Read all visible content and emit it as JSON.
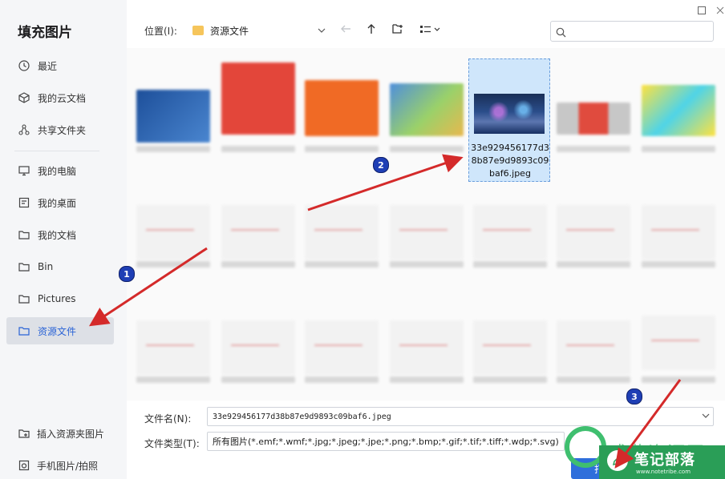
{
  "dialog": {
    "title": "填充图片"
  },
  "sidebar": {
    "items": [
      {
        "label": "最近",
        "icon": "clock-icon"
      },
      {
        "label": "我的云文档",
        "icon": "cloud-cube-icon"
      },
      {
        "label": "共享文件夹",
        "icon": "share-icon"
      },
      {
        "label": "我的电脑",
        "icon": "monitor-icon"
      },
      {
        "label": "我的桌面",
        "icon": "desktop-icon"
      },
      {
        "label": "我的文档",
        "icon": "folder-icon"
      },
      {
        "label": "Bin",
        "icon": "folder-icon"
      },
      {
        "label": "Pictures",
        "icon": "folder-icon"
      },
      {
        "label": "资源文件",
        "icon": "folder-icon",
        "active": true
      }
    ],
    "bottom": [
      {
        "label": "插入资源夹图片",
        "icon": "insert-folder-icon"
      },
      {
        "label": "手机图片/拍照",
        "icon": "phone-camera-icon"
      }
    ]
  },
  "toolbar": {
    "location_label": "位置(I):",
    "location_value": "资源文件",
    "search_placeholder": ""
  },
  "selected_file": {
    "name": "33e929456177d38b87e9d9893c09baf6.jpeg"
  },
  "footer": {
    "filename_label": "文件名(N):",
    "filename_value": "33e929456177d38b87e9d9893c09baf6.jpeg",
    "filetype_label": "文件类型(T):",
    "filetype_value": "所有图片(*.emf;*.wmf;*.jpg;*.jpeg;*.jpe;*.png;*.bmp;*.gif;*.tif;*.tiff;*.wdp;*.svg)",
    "open_button": "打"
  },
  "annotations": {
    "badge1": "1",
    "badge2": "2",
    "badge3": "3"
  },
  "watermark": {
    "brand": "笔记部落",
    "url": "www.notetribe.com",
    "faded_text": "成燕资源网"
  },
  "colors": {
    "accent": "#2f6fdb",
    "selection": "#cfe6fb",
    "arrow": "#d42a2a",
    "badge": "#1f3fb5",
    "brand_green": "#2a9e57"
  }
}
